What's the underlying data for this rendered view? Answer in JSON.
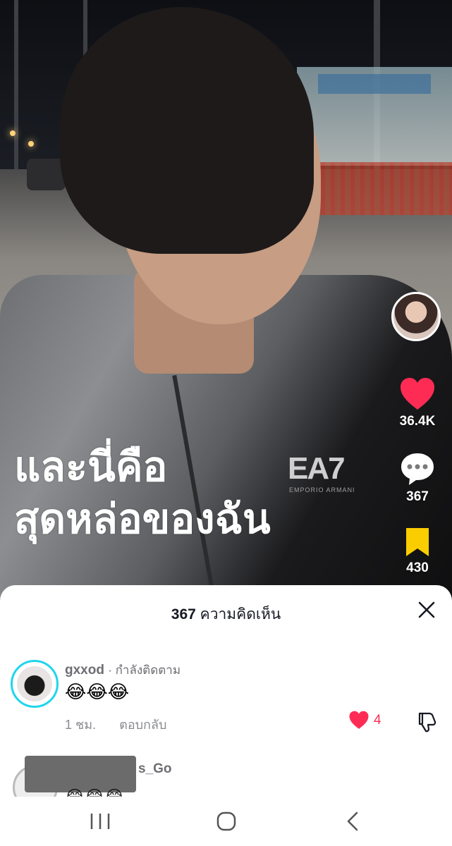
{
  "video": {
    "overlay_lines": [
      "และนี่คือ",
      "สุดหล่อของฉัน"
    ],
    "jacket_brand": "EA7",
    "jacket_brand_sub": "EMPORIO ARMANI"
  },
  "actions": {
    "likes": "36.4K",
    "comments": "367",
    "saves": "430",
    "like_color": "#fe2c55",
    "save_color": "#facd00"
  },
  "comments_sheet": {
    "count": "367",
    "title_suffix": "ความคิดเห็น",
    "items": [
      {
        "username": "gxxod",
        "status": "· กำลังติดตาม",
        "text": "😂😂😂",
        "time": "1 ชม.",
        "reply_label": "ตอบกลับ",
        "likes": "4"
      },
      {
        "username_partial": "s_Go",
        "text": "😂😂😂"
      }
    ]
  },
  "icons": {
    "close": "close-icon",
    "heart": "heart-icon",
    "comment": "comment-icon",
    "bookmark": "bookmark-icon",
    "dislike": "thumbs-down-icon",
    "nav_recents": "recents-icon",
    "nav_home": "home-icon",
    "nav_back": "back-icon"
  }
}
